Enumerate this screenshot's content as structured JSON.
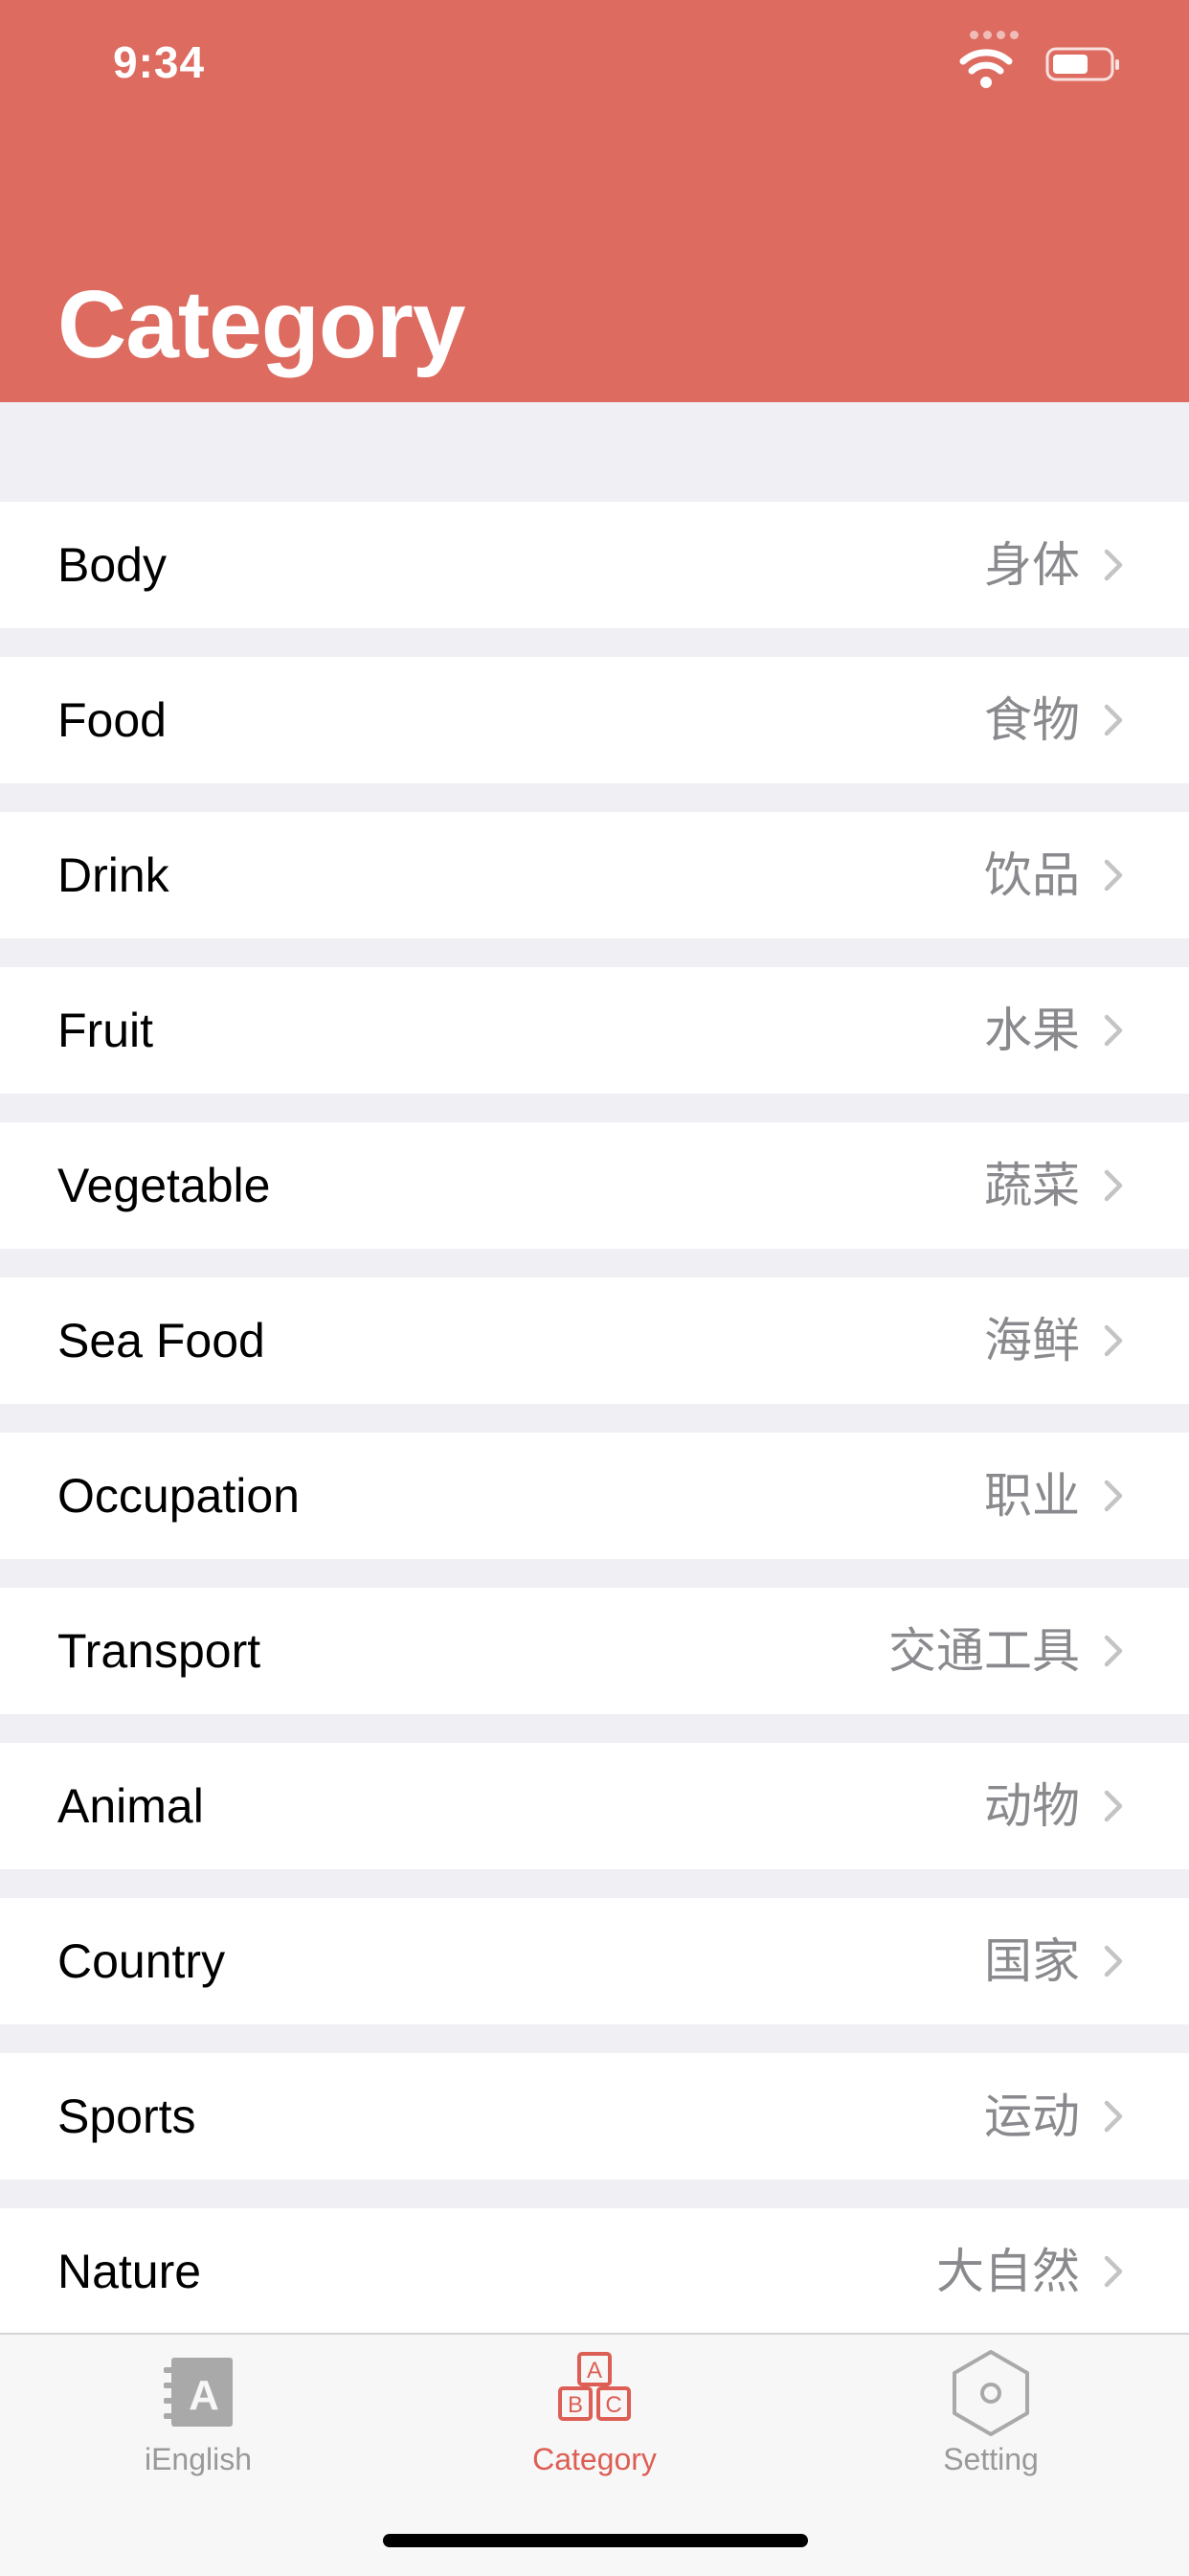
{
  "status_bar": {
    "time": "9:34"
  },
  "header": {
    "title": "Category",
    "background": "#dd6b60"
  },
  "categories": [
    {
      "en": "Body",
      "cn": "身体"
    },
    {
      "en": "Food",
      "cn": "食物"
    },
    {
      "en": "Drink",
      "cn": "饮品"
    },
    {
      "en": "Fruit",
      "cn": "水果"
    },
    {
      "en": "Vegetable",
      "cn": "蔬菜"
    },
    {
      "en": "Sea Food",
      "cn": "海鲜"
    },
    {
      "en": "Occupation",
      "cn": "职业"
    },
    {
      "en": "Transport",
      "cn": "交通工具"
    },
    {
      "en": "Animal",
      "cn": "动物"
    },
    {
      "en": "Country",
      "cn": "国家"
    },
    {
      "en": "Sports",
      "cn": "运动"
    },
    {
      "en": "Nature",
      "cn": "大自然"
    }
  ],
  "tabbar": {
    "tabs": [
      {
        "label": "iEnglish",
        "icon": "book-a-icon",
        "active": false
      },
      {
        "label": "Category",
        "icon": "abc-blocks-icon",
        "active": true
      },
      {
        "label": "Setting",
        "icon": "hexagon-gear-icon",
        "active": false
      }
    ],
    "active_color": "#dd5e54",
    "inactive_color": "#999999"
  }
}
